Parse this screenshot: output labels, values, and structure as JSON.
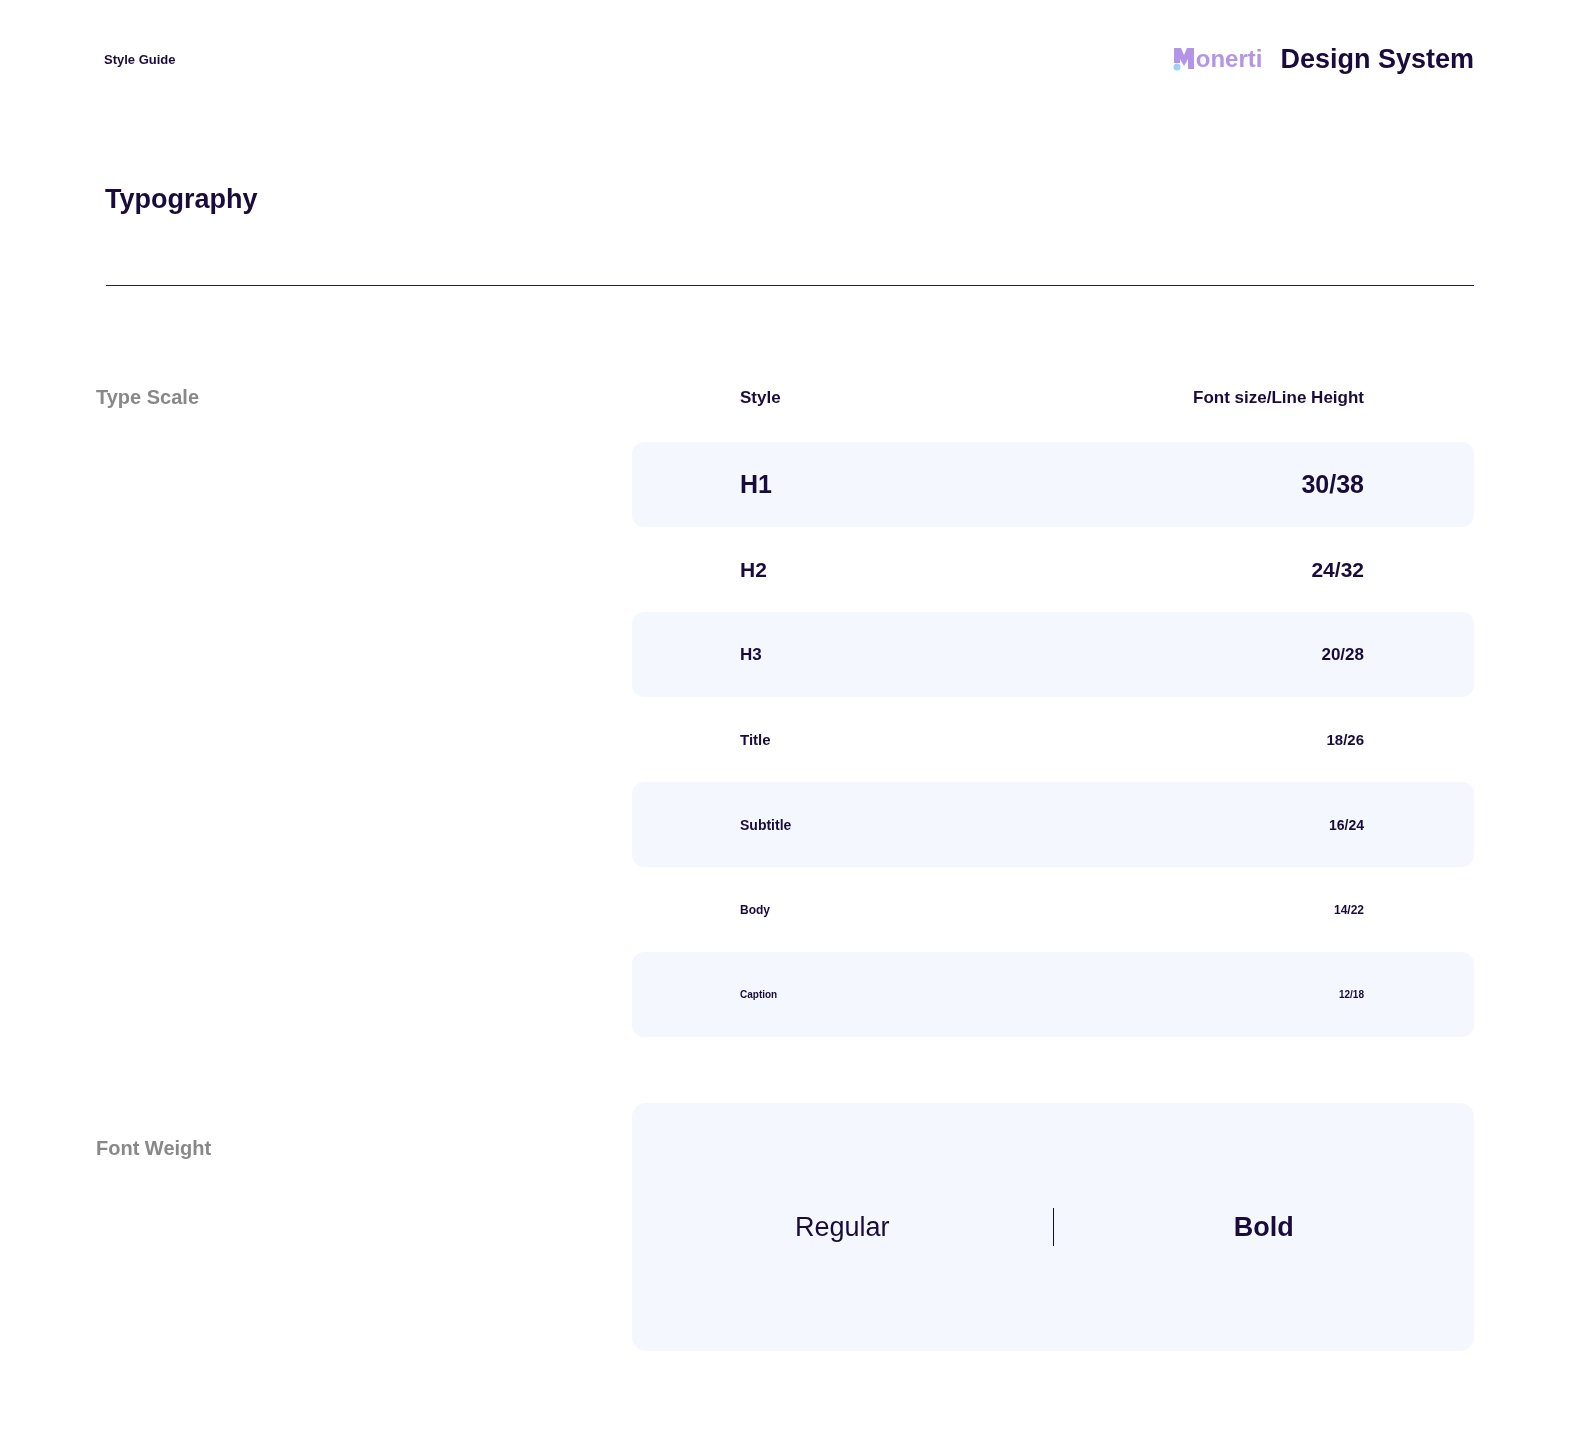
{
  "header": {
    "label": "Style Guide",
    "logo_text": "onerti",
    "title": "Design System"
  },
  "page_title": "Typography",
  "type_scale": {
    "label": "Type Scale",
    "columns": [
      "Style",
      "Font size/Line Height"
    ],
    "rows": [
      {
        "style": "H1",
        "size": "30/38"
      },
      {
        "style": "H2",
        "size": "24/32"
      },
      {
        "style": "H3",
        "size": "20/28"
      },
      {
        "style": "Title",
        "size": "18/26"
      },
      {
        "style": "Subtitle",
        "size": "16/24"
      },
      {
        "style": "Body",
        "size": "14/22"
      },
      {
        "style": "Caption",
        "size": "12/18"
      }
    ]
  },
  "font_weight": {
    "label": "Font Weight",
    "samples": [
      {
        "text": "Regular",
        "kind": "regular"
      },
      {
        "text": "Bold",
        "kind": "bold"
      }
    ]
  }
}
